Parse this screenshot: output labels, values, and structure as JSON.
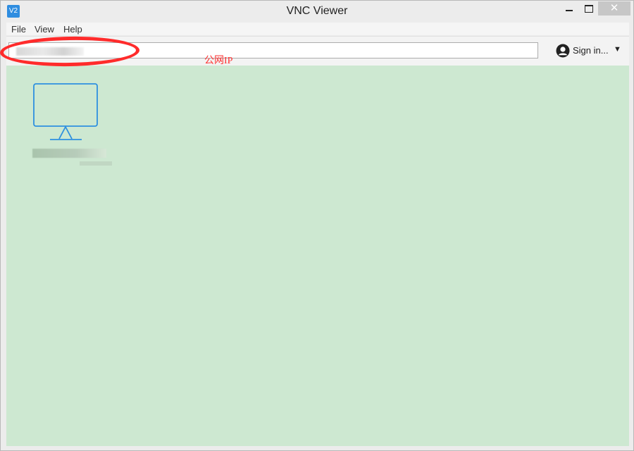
{
  "window": {
    "title": "VNC Viewer",
    "app_icon_text": "V2",
    "close_symbol": "✕"
  },
  "menu": {
    "items": [
      "File",
      "View",
      "Help"
    ]
  },
  "toolbar": {
    "address_value": "",
    "signin_label": "Sign in...",
    "caret": "▼"
  },
  "annotation": {
    "text": "公网IP",
    "color": "#ff2b2b"
  },
  "colors": {
    "content_bg": "#cde8d1",
    "monitor_stroke": "#2e90df"
  }
}
